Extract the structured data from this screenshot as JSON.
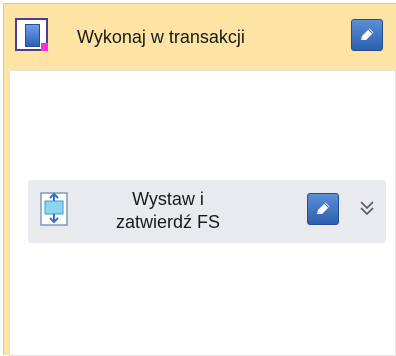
{
  "header": {
    "title": "Wykonaj w transakcji",
    "icon": "transaction-icon",
    "edit_icon": "pencil-icon"
  },
  "action": {
    "label_line1": "Wystaw i",
    "label_line2": "zatwierdź FS",
    "icon": "document-convert-icon",
    "edit_icon": "pencil-icon",
    "expand_icon": "double-chevron-down-icon"
  },
  "colors": {
    "header_bg": "#fde4a4",
    "button_blue": "#3b6fc0",
    "action_row_bg": "#e8eaee",
    "accent_pink": "#ff2fd0"
  }
}
